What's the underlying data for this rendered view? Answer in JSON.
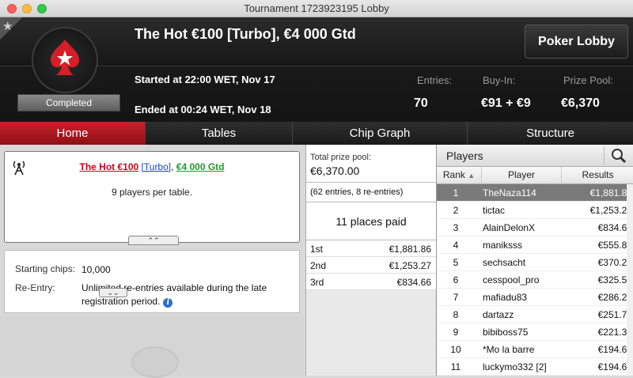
{
  "window": {
    "title": "Tournament 1723923195 Lobby"
  },
  "header": {
    "tournament_title": "The Hot €100 [Turbo], €4 000 Gtd",
    "lobby_button": "Poker Lobby",
    "status": "Completed",
    "started": "Started at 22:00 WET, Nov 17",
    "ended": "Ended at 00:24 WET, Nov 18",
    "stats": [
      {
        "label": "Entries:",
        "value": "70"
      },
      {
        "label": "Buy-In:",
        "value": "€91 + €9"
      },
      {
        "label": "Prize Pool:",
        "value": "€6,370"
      }
    ]
  },
  "tabs": [
    {
      "label": "Home",
      "active": true
    },
    {
      "label": "Tables",
      "active": false
    },
    {
      "label": "Chip Graph",
      "active": false
    },
    {
      "label": "Structure",
      "active": false
    }
  ],
  "info": {
    "title_red": "The Hot €100",
    "title_blue": "[Turbo]",
    "title_sep": ", ",
    "title_green": "€4 000 Gtd",
    "per_table": "9 players per table."
  },
  "details": {
    "starting_chips_label": "Starting chips:",
    "starting_chips_value": "10,000",
    "reentry_label": "Re-Entry:",
    "reentry_value": "Unlimited re-entries available during the late registration period."
  },
  "prizes": {
    "label": "Total prize pool:",
    "total": "€6,370.00",
    "entries_note": "(62 entries, 8 re-entries)",
    "places_paid": "11 places paid",
    "payouts": [
      {
        "place": "1st",
        "amount": "€1,881.86"
      },
      {
        "place": "2nd",
        "amount": "€1,253.27"
      },
      {
        "place": "3rd",
        "amount": "€834.66"
      }
    ]
  },
  "players": {
    "title": "Players",
    "columns": {
      "rank": "Rank",
      "player": "Player",
      "results": "Results"
    },
    "rows": [
      {
        "rank": "1",
        "name": "TheNaza114",
        "result": "€1,881.86"
      },
      {
        "rank": "2",
        "name": "tictac",
        "result": "€1,253.27"
      },
      {
        "rank": "3",
        "name": "AlainDelonX",
        "result": "€834.66"
      },
      {
        "rank": "4",
        "name": "maniksss",
        "result": "€555.88"
      },
      {
        "rank": "5",
        "name": "sechsacht",
        "result": "€370.21"
      },
      {
        "rank": "6",
        "name": "cesspool_pro",
        "result": "€325.54"
      },
      {
        "rank": "7",
        "name": "mafiadu83",
        "result": "€286.26"
      },
      {
        "rank": "8",
        "name": "dartazz",
        "result": "€251.72"
      },
      {
        "rank": "9",
        "name": "bibiboss75",
        "result": "€221.34"
      },
      {
        "rank": "10",
        "name": "*Mo la barre",
        "result": "€194.63"
      },
      {
        "rank": "11",
        "name": "luckymo332 [2]",
        "result": "€194.63"
      }
    ]
  },
  "colors": {
    "accent_red": "#c8222a",
    "selected_row": "#7a7a7a"
  },
  "icons": [
    "star-icon",
    "pokerstars-logo",
    "antenna-icon",
    "info-icon",
    "search-icon",
    "sort-arrow-icon",
    "expand-icon"
  ]
}
